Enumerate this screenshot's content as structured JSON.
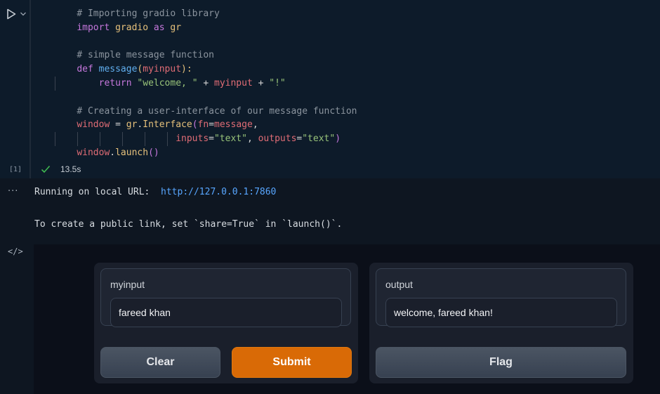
{
  "cell": {
    "execution_count": "[1]",
    "status_time": "13.5s",
    "code_lines": [
      [
        {
          "t": "    ",
          "c": "plain"
        },
        {
          "t": "# Importing gradio library",
          "c": "comment"
        }
      ],
      [
        {
          "t": "    ",
          "c": "plain"
        },
        {
          "t": "import",
          "c": "kw"
        },
        {
          "t": " gradio ",
          "c": "ident"
        },
        {
          "t": "as",
          "c": "kw"
        },
        {
          "t": " gr",
          "c": "ident"
        }
      ],
      [
        {
          "t": "",
          "c": "plain"
        }
      ],
      [
        {
          "t": "    ",
          "c": "plain"
        },
        {
          "t": "# simple message function",
          "c": "comment"
        }
      ],
      [
        {
          "t": "    ",
          "c": "plain"
        },
        {
          "t": "def",
          "c": "kw"
        },
        {
          "t": " ",
          "c": "plain"
        },
        {
          "t": "message",
          "c": "fn"
        },
        {
          "t": "(",
          "c": "paren1"
        },
        {
          "t": "myinput",
          "c": "param"
        },
        {
          "t": "):",
          "c": "paren1"
        }
      ],
      [
        {
          "t": "        ",
          "c": "plain"
        },
        {
          "t": "return",
          "c": "kw"
        },
        {
          "t": " ",
          "c": "plain"
        },
        {
          "t": "\"welcome, \"",
          "c": "str"
        },
        {
          "t": " + ",
          "c": "plain"
        },
        {
          "t": "myinput",
          "c": "param"
        },
        {
          "t": " + ",
          "c": "plain"
        },
        {
          "t": "\"!\"",
          "c": "str"
        }
      ],
      [
        {
          "t": "",
          "c": "plain"
        }
      ],
      [
        {
          "t": "    ",
          "c": "plain"
        },
        {
          "t": "# Creating a user-interface of our message function",
          "c": "comment"
        }
      ],
      [
        {
          "t": "    ",
          "c": "plain"
        },
        {
          "t": "window",
          "c": "param"
        },
        {
          "t": " = ",
          "c": "plain"
        },
        {
          "t": "gr",
          "c": "ident"
        },
        {
          "t": ".",
          "c": "plain"
        },
        {
          "t": "Interface",
          "c": "ident"
        },
        {
          "t": "(",
          "c": "paren2"
        },
        {
          "t": "fn",
          "c": "param"
        },
        {
          "t": "=",
          "c": "plain"
        },
        {
          "t": "message",
          "c": "param"
        },
        {
          "t": ",",
          "c": "plain"
        }
      ],
      [
        {
          "t": "                      ",
          "c": "plain"
        },
        {
          "t": "inputs",
          "c": "param"
        },
        {
          "t": "=",
          "c": "plain"
        },
        {
          "t": "\"text\"",
          "c": "str"
        },
        {
          "t": ", ",
          "c": "plain"
        },
        {
          "t": "outputs",
          "c": "param"
        },
        {
          "t": "=",
          "c": "plain"
        },
        {
          "t": "\"text\"",
          "c": "str"
        },
        {
          "t": ")",
          "c": "paren2"
        }
      ],
      [
        {
          "t": "    ",
          "c": "plain"
        },
        {
          "t": "window",
          "c": "param"
        },
        {
          "t": ".",
          "c": "plain"
        },
        {
          "t": "launch",
          "c": "ident"
        },
        {
          "t": "()",
          "c": "paren2"
        }
      ]
    ]
  },
  "output": {
    "menu_glyph": "···",
    "running_text": "Running on local URL:  ",
    "local_url": "http://127.0.0.1:7860",
    "share_hint": "To create a public link, set `share=True` in `launch()`.",
    "embed_icon": "</>"
  },
  "gradio": {
    "input_label": "myinput",
    "input_value": "fareed khan",
    "output_label": "output",
    "output_value": "welcome, fareed khan!",
    "clear_label": "Clear",
    "submit_label": "Submit",
    "flag_label": "Flag"
  },
  "colors": {
    "accent_submit": "#d96a06",
    "success_check": "#3fb950",
    "link": "#58a6ff"
  }
}
